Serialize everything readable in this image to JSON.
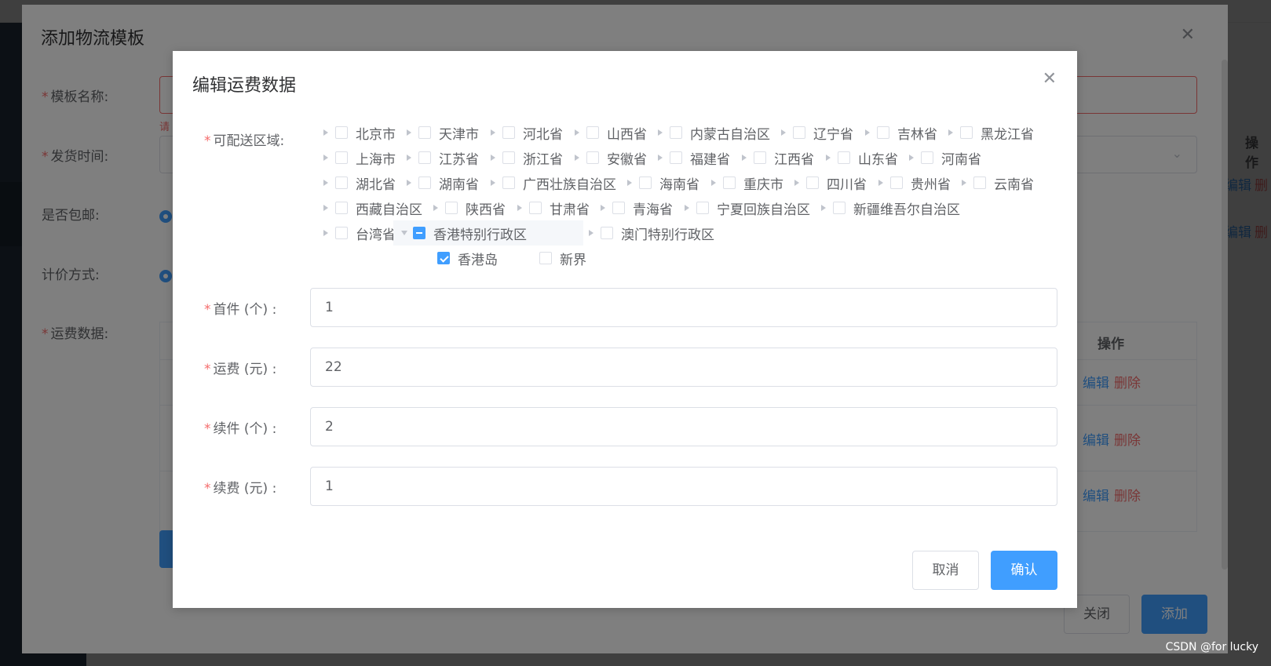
{
  "outer_dialog": {
    "title": "添加物流模板",
    "labels": {
      "template_name": "模板名称:",
      "ship_time": "发货时间:",
      "free_shipping": "是否包邮:",
      "pricing": "计价方式:",
      "freight_data": "运费数据:"
    },
    "error_partial": "请",
    "table_op_header": "操作",
    "row_links": [
      {
        "edit": "编辑",
        "delete": "删除"
      },
      {
        "edit": "编辑",
        "delete": "删除"
      },
      {
        "edit": "编辑",
        "delete": "删除"
      }
    ],
    "close_button": "关闭",
    "add_button": "添加"
  },
  "background_page": {
    "op_header": "操作",
    "links": [
      {
        "edit": "编辑",
        "delete": "删"
      },
      {
        "edit": "编辑",
        "delete": "删"
      }
    ]
  },
  "inner_dialog": {
    "title": "编辑运费数据",
    "area_label": "可配送区域:",
    "tree_rows": [
      [
        {
          "name": "北京市",
          "state": "unchecked"
        },
        {
          "name": "天津市",
          "state": "unchecked"
        },
        {
          "name": "河北省",
          "state": "unchecked"
        },
        {
          "name": "山西省",
          "state": "unchecked"
        },
        {
          "name": "内蒙古自治区",
          "state": "unchecked"
        },
        {
          "name": "辽宁省",
          "state": "unchecked"
        },
        {
          "name": "吉林省",
          "state": "unchecked"
        },
        {
          "name": "黑龙江省",
          "state": "unchecked"
        }
      ],
      [
        {
          "name": "上海市",
          "state": "unchecked"
        },
        {
          "name": "江苏省",
          "state": "unchecked"
        },
        {
          "name": "浙江省",
          "state": "unchecked"
        },
        {
          "name": "安徽省",
          "state": "unchecked"
        },
        {
          "name": "福建省",
          "state": "unchecked"
        },
        {
          "name": "江西省",
          "state": "unchecked"
        },
        {
          "name": "山东省",
          "state": "unchecked"
        },
        {
          "name": "河南省",
          "state": "unchecked"
        }
      ],
      [
        {
          "name": "湖北省",
          "state": "unchecked"
        },
        {
          "name": "湖南省",
          "state": "unchecked"
        },
        {
          "name": "广西壮族自治区",
          "state": "unchecked"
        },
        {
          "name": "海南省",
          "state": "unchecked"
        },
        {
          "name": "重庆市",
          "state": "unchecked"
        },
        {
          "name": "四川省",
          "state": "unchecked"
        },
        {
          "name": "贵州省",
          "state": "unchecked"
        },
        {
          "name": "云南省",
          "state": "unchecked"
        }
      ],
      [
        {
          "name": "西藏自治区",
          "state": "unchecked"
        },
        {
          "name": "陕西省",
          "state": "unchecked"
        },
        {
          "name": "甘肃省",
          "state": "unchecked"
        },
        {
          "name": "青海省",
          "state": "unchecked"
        },
        {
          "name": "宁夏回族自治区",
          "state": "unchecked"
        },
        {
          "name": "新疆维吾尔自治区",
          "state": "unchecked"
        }
      ],
      [
        {
          "name": "台湾省",
          "state": "unchecked"
        },
        {
          "name": "香港特别行政区",
          "state": "indeterminate",
          "expanded": true
        },
        {
          "name": "澳门特别行政区",
          "state": "unchecked"
        }
      ]
    ],
    "hk_children": [
      {
        "name": "香港岛",
        "state": "checked"
      },
      {
        "name": "新界",
        "state": "unchecked"
      }
    ],
    "fields": [
      {
        "label": "首件 (个) :",
        "value": "1"
      },
      {
        "label": "运费 (元) :",
        "value": "22"
      },
      {
        "label": "续件 (个) :",
        "value": "2"
      },
      {
        "label": "续费 (元) :",
        "value": "1"
      }
    ],
    "cancel_button": "取消",
    "confirm_button": "确认"
  },
  "watermark": "CSDN @for lucky",
  "colors": {
    "primary": "#409eff",
    "danger": "#f56c6c",
    "text": "#606266"
  }
}
